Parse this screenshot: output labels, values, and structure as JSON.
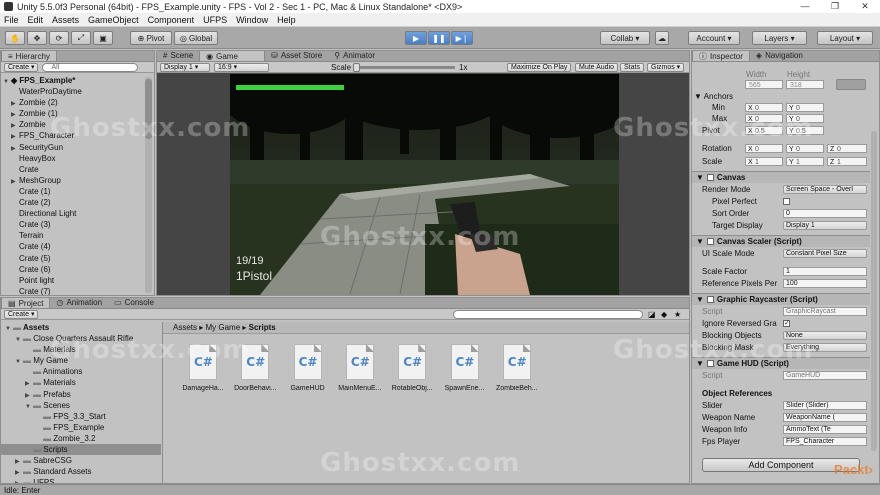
{
  "window": {
    "title": "Unity 5.5.0f3 Personal (64bit) - FPS_Example.unity - FPS - Vol 2 - Sec 1 - PC, Mac & Linux Standalone* <DX9>",
    "minimize": "—",
    "maximize": "❐",
    "close": "✕"
  },
  "menu": [
    "File",
    "Edit",
    "Assets",
    "GameObject",
    "Component",
    "UFPS",
    "Window",
    "Help"
  ],
  "toolbar": {
    "pivot": "Pivot",
    "global": "Global",
    "collab": "Collab ▾",
    "account": "Account ▾",
    "layers": "Layers ▾",
    "layout": "Layout ▾"
  },
  "hierarchy": {
    "tab": "Hierarchy",
    "create": "Create ▾",
    "search": "All",
    "scene": "FPS_Example*",
    "items": [
      {
        "label": "WaterProDaytime",
        "arrow": ""
      },
      {
        "label": "Zombie (2)",
        "arrow": "▶"
      },
      {
        "label": "Zombie (1)",
        "arrow": "▶"
      },
      {
        "label": "Zombie",
        "arrow": "▶"
      },
      {
        "label": "FPS_Character",
        "arrow": "▶"
      },
      {
        "label": "SecurityGun",
        "arrow": "▶"
      },
      {
        "label": "HeavyBox",
        "arrow": ""
      },
      {
        "label": "Crate",
        "arrow": ""
      },
      {
        "label": "MeshGroup",
        "arrow": "▶"
      },
      {
        "label": "Crate (1)",
        "arrow": ""
      },
      {
        "label": "Crate (2)",
        "arrow": ""
      },
      {
        "label": "Directional Light",
        "arrow": ""
      },
      {
        "label": "Crate (3)",
        "arrow": ""
      },
      {
        "label": "Terrain",
        "arrow": ""
      },
      {
        "label": "Crate (4)",
        "arrow": ""
      },
      {
        "label": "Crate (5)",
        "arrow": ""
      },
      {
        "label": "Crate (6)",
        "arrow": ""
      },
      {
        "label": "Point light",
        "arrow": ""
      },
      {
        "label": "Crate (7)",
        "arrow": ""
      }
    ]
  },
  "center": {
    "tabs": [
      "Scene",
      "Game",
      "Asset Store",
      "Animator"
    ],
    "display": "Display 1 ▾",
    "aspect": "16:9 ▾",
    "scale_label": "Scale",
    "scale_value": "1x",
    "maximize": "Maximize On Play",
    "mute": "Mute Audio",
    "stats": "Stats",
    "gizmos": "Gizmos ▾",
    "hud_ammo": "19/19",
    "hud_weapon": "1Pistol",
    "health": 0.42
  },
  "inspector": {
    "tabs": [
      "Inspector",
      "Navigation"
    ],
    "width_label": "Width",
    "height_label": "Height",
    "width": "565",
    "height": "318",
    "anchors": "Anchors",
    "min": "Min",
    "max": "Max",
    "pivot": "Pivot",
    "min_x": "0",
    "min_y": "0",
    "max_x": "0",
    "max_y": "0",
    "pivot_x": "0.5",
    "pivot_y": "0.5",
    "rotation": "Rotation",
    "scale": "Scale",
    "rot_x": "0",
    "rot_y": "0",
    "rot_z": "0",
    "sc_x": "1",
    "sc_y": "1",
    "sc_z": "1",
    "canvas": "Canvas",
    "render_mode_label": "Render Mode",
    "render_mode": "Screen Space - Overl",
    "pixel_perfect": "Pixel Perfect",
    "sort_order_label": "Sort Order",
    "sort_order": "0",
    "target_display_label": "Target Display",
    "target_display": "Display 1",
    "scaler": "Canvas Scaler (Script)",
    "ui_scale_mode_label": "UI Scale Mode",
    "ui_scale_mode": "Constant Pixel Size",
    "scale_factor_label": "Scale Factor",
    "scale_factor": "1",
    "ref_ppu_label": "Reference Pixels Per",
    "ref_ppu": "100",
    "raycaster": "Graphic Raycaster (Script)",
    "script_label": "Script",
    "raycaster_script": "GraphicRaycast",
    "ignore_reversed": "Ignore Reversed Gra",
    "blocking_objects_label": "Blocking Objects",
    "blocking_objects": "None",
    "blocking_mask_label": "Blocking Mask",
    "blocking_mask": "Everything",
    "gamehud": "Game HUD (Script)",
    "gamehud_script": "GameHUD",
    "object_refs": "Object References",
    "slider_label": "Slider",
    "slider_val": "Slider (Slider)",
    "weapon_name_label": "Weapon Name",
    "weapon_name_val": "WeaponName (",
    "weapon_info_label": "Weapon Info",
    "weapon_info_val": "AmmoText (Te",
    "fps_player_label": "Fps Player",
    "fps_player_val": "FPS_Character",
    "add_component": "Add Component"
  },
  "project": {
    "tabs": [
      "Project",
      "Animation",
      "Console"
    ],
    "create": "Create ▾",
    "breadcrumb": [
      "Assets",
      "My Game",
      "Scripts"
    ],
    "tree": [
      {
        "label": "Assets",
        "indent": 0,
        "arrow": "▼",
        "bold": true
      },
      {
        "label": "Close Quarters Assault Rifle",
        "indent": 1,
        "arrow": "▼"
      },
      {
        "label": "Materials",
        "indent": 2,
        "arrow": ""
      },
      {
        "label": "My Game",
        "indent": 1,
        "arrow": "▼"
      },
      {
        "label": "Animations",
        "indent": 2,
        "arrow": ""
      },
      {
        "label": "Materials",
        "indent": 2,
        "arrow": "▶"
      },
      {
        "label": "Prefabs",
        "indent": 2,
        "arrow": "▶"
      },
      {
        "label": "Scenes",
        "indent": 2,
        "arrow": "▼"
      },
      {
        "label": "FPS_3.3_Start",
        "indent": 3,
        "arrow": ""
      },
      {
        "label": "FPS_Example",
        "indent": 3,
        "arrow": ""
      },
      {
        "label": "Zombie_3.2",
        "indent": 3,
        "arrow": ""
      },
      {
        "label": "Scripts",
        "indent": 2,
        "arrow": "",
        "selected": true
      },
      {
        "label": "SabreCSG",
        "indent": 1,
        "arrow": "▶"
      },
      {
        "label": "Standard Assets",
        "indent": 1,
        "arrow": "▶"
      },
      {
        "label": "UFPS",
        "indent": 1,
        "arrow": "▶"
      }
    ],
    "files": [
      "DamageHa...",
      "DoorBehavi...",
      "GameHUD",
      "MainMenuE...",
      "RotableObj...",
      "SpawnEne...",
      "ZombieBeh..."
    ]
  },
  "status": "Idle: Enter",
  "watermark": "Ghostxx.com",
  "corner_logo": "Packt›"
}
